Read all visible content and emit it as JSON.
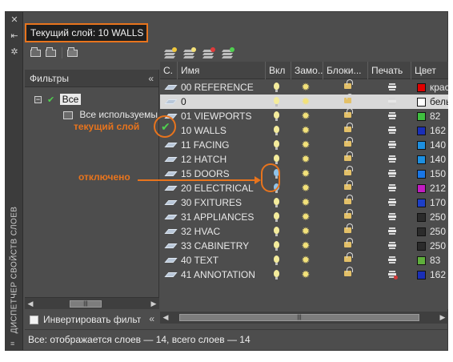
{
  "current_layer": "Текущий слой: 10 WALLS",
  "side_title": "ДИСПЕТЧЕР СВОЙСТВ СЛОЕВ",
  "filters": {
    "header": "Фильтры",
    "collapse_glyph": "«",
    "root_label": "Все",
    "child_label": "Все используемые слои",
    "invert_label": "Инвертировать фильтр"
  },
  "columns": {
    "status": "С.",
    "name": "Имя",
    "on": "Вкл",
    "freeze": "Замо...",
    "lock": "Блоки...",
    "plot": "Печать",
    "color": "Цвет"
  },
  "layers": [
    {
      "name": "00 REFERENCE",
      "on": true,
      "plot": true,
      "color_name": "красный",
      "color_hex": "#e00000",
      "selected": false
    },
    {
      "name": "0",
      "on": true,
      "plot": true,
      "color_name": "белый",
      "color_hex": "#ffffff",
      "selected": true
    },
    {
      "name": "01 VIEWPORTS",
      "on": true,
      "plot": true,
      "color_name": "82",
      "color_hex": "#3fbf3f",
      "selected": false
    },
    {
      "name": "10 WALLS",
      "on": true,
      "plot": true,
      "color_name": "162",
      "color_hex": "#1a2fb8",
      "selected": false,
      "current": true
    },
    {
      "name": "11 FACING",
      "on": true,
      "plot": true,
      "color_name": "140",
      "color_hex": "#1d8fe0",
      "selected": false
    },
    {
      "name": "12 HATCH",
      "on": true,
      "plot": true,
      "color_name": "140",
      "color_hex": "#1d8fe0",
      "selected": false
    },
    {
      "name": "15 DOORS",
      "on": false,
      "plot": true,
      "color_name": "150",
      "color_hex": "#1976e6",
      "selected": false
    },
    {
      "name": "20 ELECTRICAL",
      "on": false,
      "plot": true,
      "color_name": "212",
      "color_hex": "#c21cc2",
      "selected": false
    },
    {
      "name": "30 FXITURES",
      "on": true,
      "plot": true,
      "color_name": "170",
      "color_hex": "#1d3fc8",
      "selected": false
    },
    {
      "name": "31 APPLIANCES",
      "on": true,
      "plot": true,
      "color_name": "250",
      "color_hex": "#2b2b2b",
      "selected": false
    },
    {
      "name": "32 HVAC",
      "on": true,
      "plot": true,
      "color_name": "250",
      "color_hex": "#2b2b2b",
      "selected": false
    },
    {
      "name": "33 CABINETRY",
      "on": true,
      "plot": true,
      "color_name": "250",
      "color_hex": "#2b2b2b",
      "selected": false
    },
    {
      "name": "40 TEXT",
      "on": true,
      "plot": true,
      "color_name": "83",
      "color_hex": "#5fae3c",
      "selected": false
    },
    {
      "name": "41 ANNOTATION",
      "on": true,
      "plot": false,
      "color_name": "162",
      "color_hex": "#1a2fb8",
      "selected": false
    }
  ],
  "callouts": {
    "current": "текущий слой",
    "off": "отключено"
  },
  "status_text": "Все: отображается слоев — 14, всего слоев — 14",
  "accent": "#e8741d",
  "icons": {
    "layer_state": "layer-parallelogram-icon",
    "on": "lightbulb-icon",
    "freeze": "sun-icon",
    "lock": "padlock-icon",
    "plot": "printer-icon"
  }
}
